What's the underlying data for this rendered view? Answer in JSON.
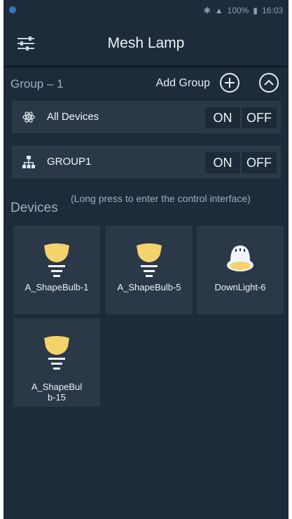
{
  "app": {
    "title": "Mesh Lamp"
  },
  "status": {
    "battery": "100%",
    "time": "16:03"
  },
  "group_header": {
    "title": "Group – 1",
    "add_label": "Add Group"
  },
  "groups": [
    {
      "name": "All Devices",
      "on_label": "ON",
      "off_label": "OFF",
      "icon": "atom-icon"
    },
    {
      "name": "GROUP1",
      "on_label": "ON",
      "off_label": "OFF",
      "icon": "network-icon"
    }
  ],
  "devices_section": {
    "title": "Devices",
    "hint": "(Long press to enter the control interface)"
  },
  "devices": [
    {
      "name": "A_ShapeBulb-1",
      "type": "bulb"
    },
    {
      "name": "A_ShapeBulb-5",
      "type": "bulb"
    },
    {
      "name": "DownLight-6",
      "type": "downlight"
    },
    {
      "name": "A_ShapeBulb-15",
      "type": "bulb"
    }
  ],
  "colors": {
    "background": "#1d2b3a",
    "card": "#2a3848",
    "bulb": "#f3d36b",
    "text": "#eef2f5"
  }
}
